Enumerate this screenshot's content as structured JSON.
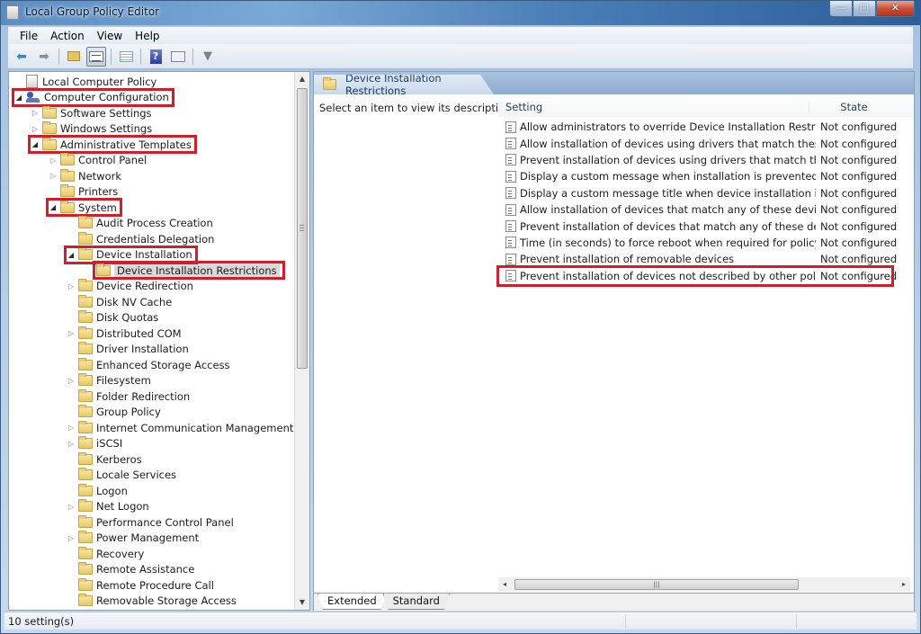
{
  "window": {
    "title": "Local Group Policy Editor",
    "controls": {
      "minimize": "—",
      "maximize": "□",
      "close": "✕"
    }
  },
  "menubar": {
    "items": [
      {
        "label": "File"
      },
      {
        "label": "Action"
      },
      {
        "label": "View"
      },
      {
        "label": "Help"
      }
    ]
  },
  "toolbar": {
    "buttons": [
      {
        "name": "back",
        "icon": "back-arrow-icon",
        "glyph": "⬅"
      },
      {
        "name": "forward",
        "icon": "forward-arrow-icon",
        "glyph": "➡"
      },
      {
        "name": "up-one-level",
        "icon": "folder-up-icon"
      },
      {
        "name": "show-hide-console-tree",
        "icon": "console-tree-icon",
        "active": true
      },
      {
        "name": "export-list",
        "icon": "export-list-icon"
      },
      {
        "name": "help",
        "icon": "help-icon",
        "glyph": "?"
      },
      {
        "name": "properties",
        "icon": "properties-icon"
      },
      {
        "name": "filter",
        "icon": "filter-icon",
        "glyph": "▼"
      }
    ]
  },
  "tree": {
    "items": [
      {
        "label": "Local Computer Policy",
        "level": 0,
        "icon": "policy",
        "expander": ""
      },
      {
        "label": "Computer Configuration",
        "level": 0,
        "icon": "computer",
        "expander": "open",
        "highlight": true
      },
      {
        "label": "Software Settings",
        "level": 1,
        "icon": "folder",
        "expander": "closed"
      },
      {
        "label": "Windows Settings",
        "level": 1,
        "icon": "folder",
        "expander": "closed"
      },
      {
        "label": "Administrative Templates",
        "level": 1,
        "icon": "folder",
        "expander": "open",
        "highlight": true
      },
      {
        "label": "Control Panel",
        "level": 2,
        "icon": "folder",
        "expander": "closed"
      },
      {
        "label": "Network",
        "level": 2,
        "icon": "folder",
        "expander": "closed"
      },
      {
        "label": "Printers",
        "level": 2,
        "icon": "folder",
        "expander": ""
      },
      {
        "label": "System",
        "level": 2,
        "icon": "folder",
        "expander": "open",
        "highlight": true
      },
      {
        "label": "Audit Process Creation",
        "level": 3,
        "icon": "folder",
        "expander": ""
      },
      {
        "label": "Credentials Delegation",
        "level": 3,
        "icon": "folder",
        "expander": ""
      },
      {
        "label": "Device Installation",
        "level": 3,
        "icon": "folder",
        "expander": "open",
        "highlight": true
      },
      {
        "label": "Device Installation Restrictions",
        "level": 4,
        "icon": "folder",
        "expander": "",
        "selected": true,
        "highlight": true
      },
      {
        "label": "Device Redirection",
        "level": 3,
        "icon": "folder",
        "expander": "closed"
      },
      {
        "label": "Disk NV Cache",
        "level": 3,
        "icon": "folder",
        "expander": ""
      },
      {
        "label": "Disk Quotas",
        "level": 3,
        "icon": "folder",
        "expander": ""
      },
      {
        "label": "Distributed COM",
        "level": 3,
        "icon": "folder",
        "expander": "closed"
      },
      {
        "label": "Driver Installation",
        "level": 3,
        "icon": "folder",
        "expander": ""
      },
      {
        "label": "Enhanced Storage Access",
        "level": 3,
        "icon": "folder",
        "expander": ""
      },
      {
        "label": "Filesystem",
        "level": 3,
        "icon": "folder",
        "expander": "closed"
      },
      {
        "label": "Folder Redirection",
        "level": 3,
        "icon": "folder",
        "expander": ""
      },
      {
        "label": "Group Policy",
        "level": 3,
        "icon": "folder",
        "expander": ""
      },
      {
        "label": "Internet Communication Management",
        "level": 3,
        "icon": "folder",
        "expander": "closed"
      },
      {
        "label": "iSCSI",
        "level": 3,
        "icon": "folder",
        "expander": "closed"
      },
      {
        "label": "Kerberos",
        "level": 3,
        "icon": "folder",
        "expander": ""
      },
      {
        "label": "Locale Services",
        "level": 3,
        "icon": "folder",
        "expander": ""
      },
      {
        "label": "Logon",
        "level": 3,
        "icon": "folder",
        "expander": ""
      },
      {
        "label": "Net Logon",
        "level": 3,
        "icon": "folder",
        "expander": "closed"
      },
      {
        "label": "Performance Control Panel",
        "level": 3,
        "icon": "folder",
        "expander": ""
      },
      {
        "label": "Power Management",
        "level": 3,
        "icon": "folder",
        "expander": "closed"
      },
      {
        "label": "Recovery",
        "level": 3,
        "icon": "folder",
        "expander": ""
      },
      {
        "label": "Remote Assistance",
        "level": 3,
        "icon": "folder",
        "expander": ""
      },
      {
        "label": "Remote Procedure Call",
        "level": 3,
        "icon": "folder",
        "expander": ""
      },
      {
        "label": "Removable Storage Access",
        "level": 3,
        "icon": "folder",
        "expander": ""
      }
    ]
  },
  "details": {
    "header_title": "Device Installation Restrictions",
    "description_prompt": "Select an item to view its description.",
    "columns": {
      "setting": "Setting",
      "state": "State"
    },
    "rows": [
      {
        "setting": "Allow administrators to override Device Installation Restricti...",
        "state": "Not configured"
      },
      {
        "setting": "Allow installation of devices using drivers that match these ...",
        "state": "Not configured"
      },
      {
        "setting": "Prevent installation of devices using drivers that match thes...",
        "state": "Not configured"
      },
      {
        "setting": "Display a custom message when installation is prevented by...",
        "state": "Not configured"
      },
      {
        "setting": "Display a custom message title when device installation is pr...",
        "state": "Not configured"
      },
      {
        "setting": "Allow installation of devices that match any of these device ...",
        "state": "Not configured"
      },
      {
        "setting": "Prevent installation of devices that match any of these devic...",
        "state": "Not configured"
      },
      {
        "setting": "Time (in seconds) to force reboot when required for policy c...",
        "state": "Not configured"
      },
      {
        "setting": "Prevent installation of removable devices",
        "state": "Not configured"
      },
      {
        "setting": "Prevent installation of devices not described by other policy ...",
        "state": "Not configured",
        "highlight": true
      }
    ],
    "hscroll_grip": "|||",
    "view_tabs": [
      {
        "label": "Extended",
        "active": true
      },
      {
        "label": "Standard",
        "active": false
      }
    ]
  },
  "statusbar": {
    "text": "10 setting(s)"
  },
  "colors": {
    "highlight_box": "#d01f2a",
    "selection": "#d9d9d9"
  }
}
